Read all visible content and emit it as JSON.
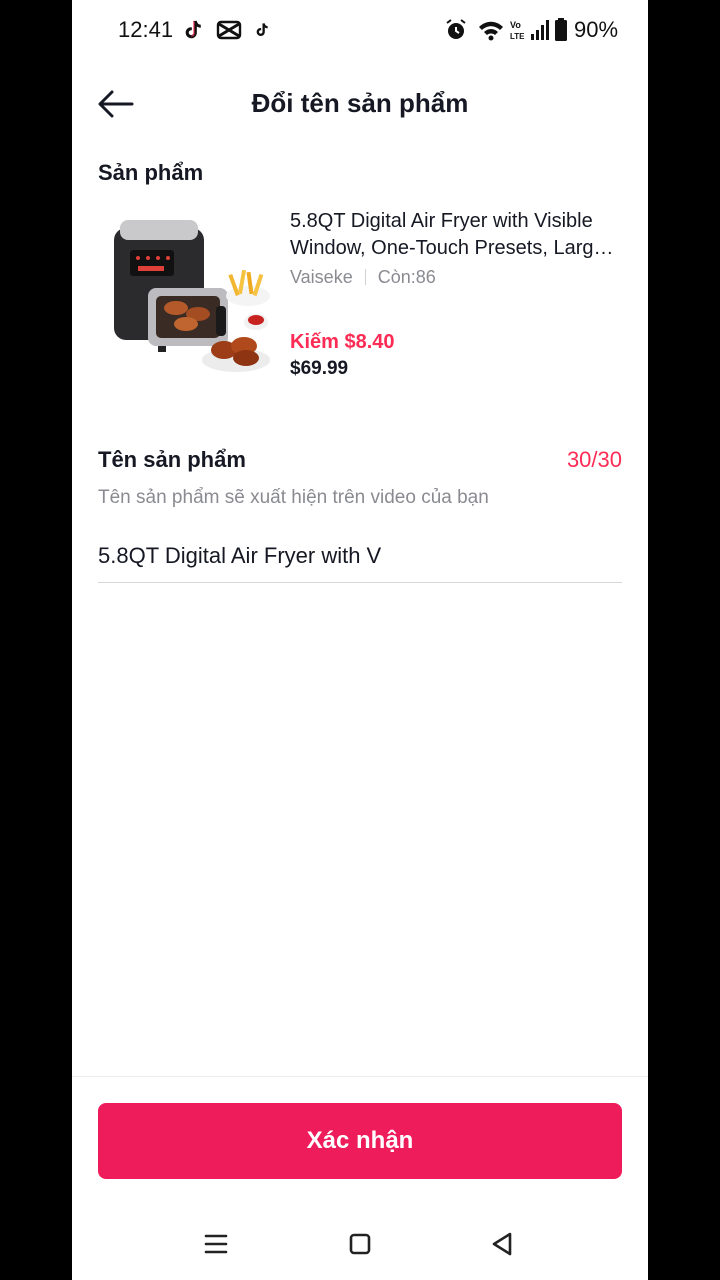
{
  "status_bar": {
    "time": "12:41",
    "battery": "90%",
    "icons": [
      "tiktok-icon",
      "capcut-icon",
      "tiktok-small-icon",
      "alarm-icon",
      "wifi-icon",
      "volte-icon",
      "signal-icon",
      "battery-icon"
    ]
  },
  "header": {
    "title": "Đổi tên sản phẩm",
    "back_icon": "arrow-left-icon"
  },
  "product_section": {
    "label": "Sản phẩm",
    "product": {
      "name": "5.8QT Digital Air Fryer with Visible Window, One-Touch Presets, Large Capacity",
      "shop": "Vaiseke",
      "stock": "Còn:86",
      "earn": "Kiếm $8.40",
      "price": "$69.99",
      "image": "air-fryer-product-image"
    }
  },
  "name_field": {
    "label": "Tên sản phẩm",
    "counter": "30/30",
    "helper": "Tên sản phẩm sẽ xuất hiện trên video của bạn",
    "value": "5.8QT Digital Air Fryer with V"
  },
  "confirm_button": {
    "label": "Xác nhận"
  },
  "colors": {
    "accent": "#fe2c55",
    "button": "#ef1c5b",
    "text": "#161823",
    "muted": "#8a8b91"
  }
}
